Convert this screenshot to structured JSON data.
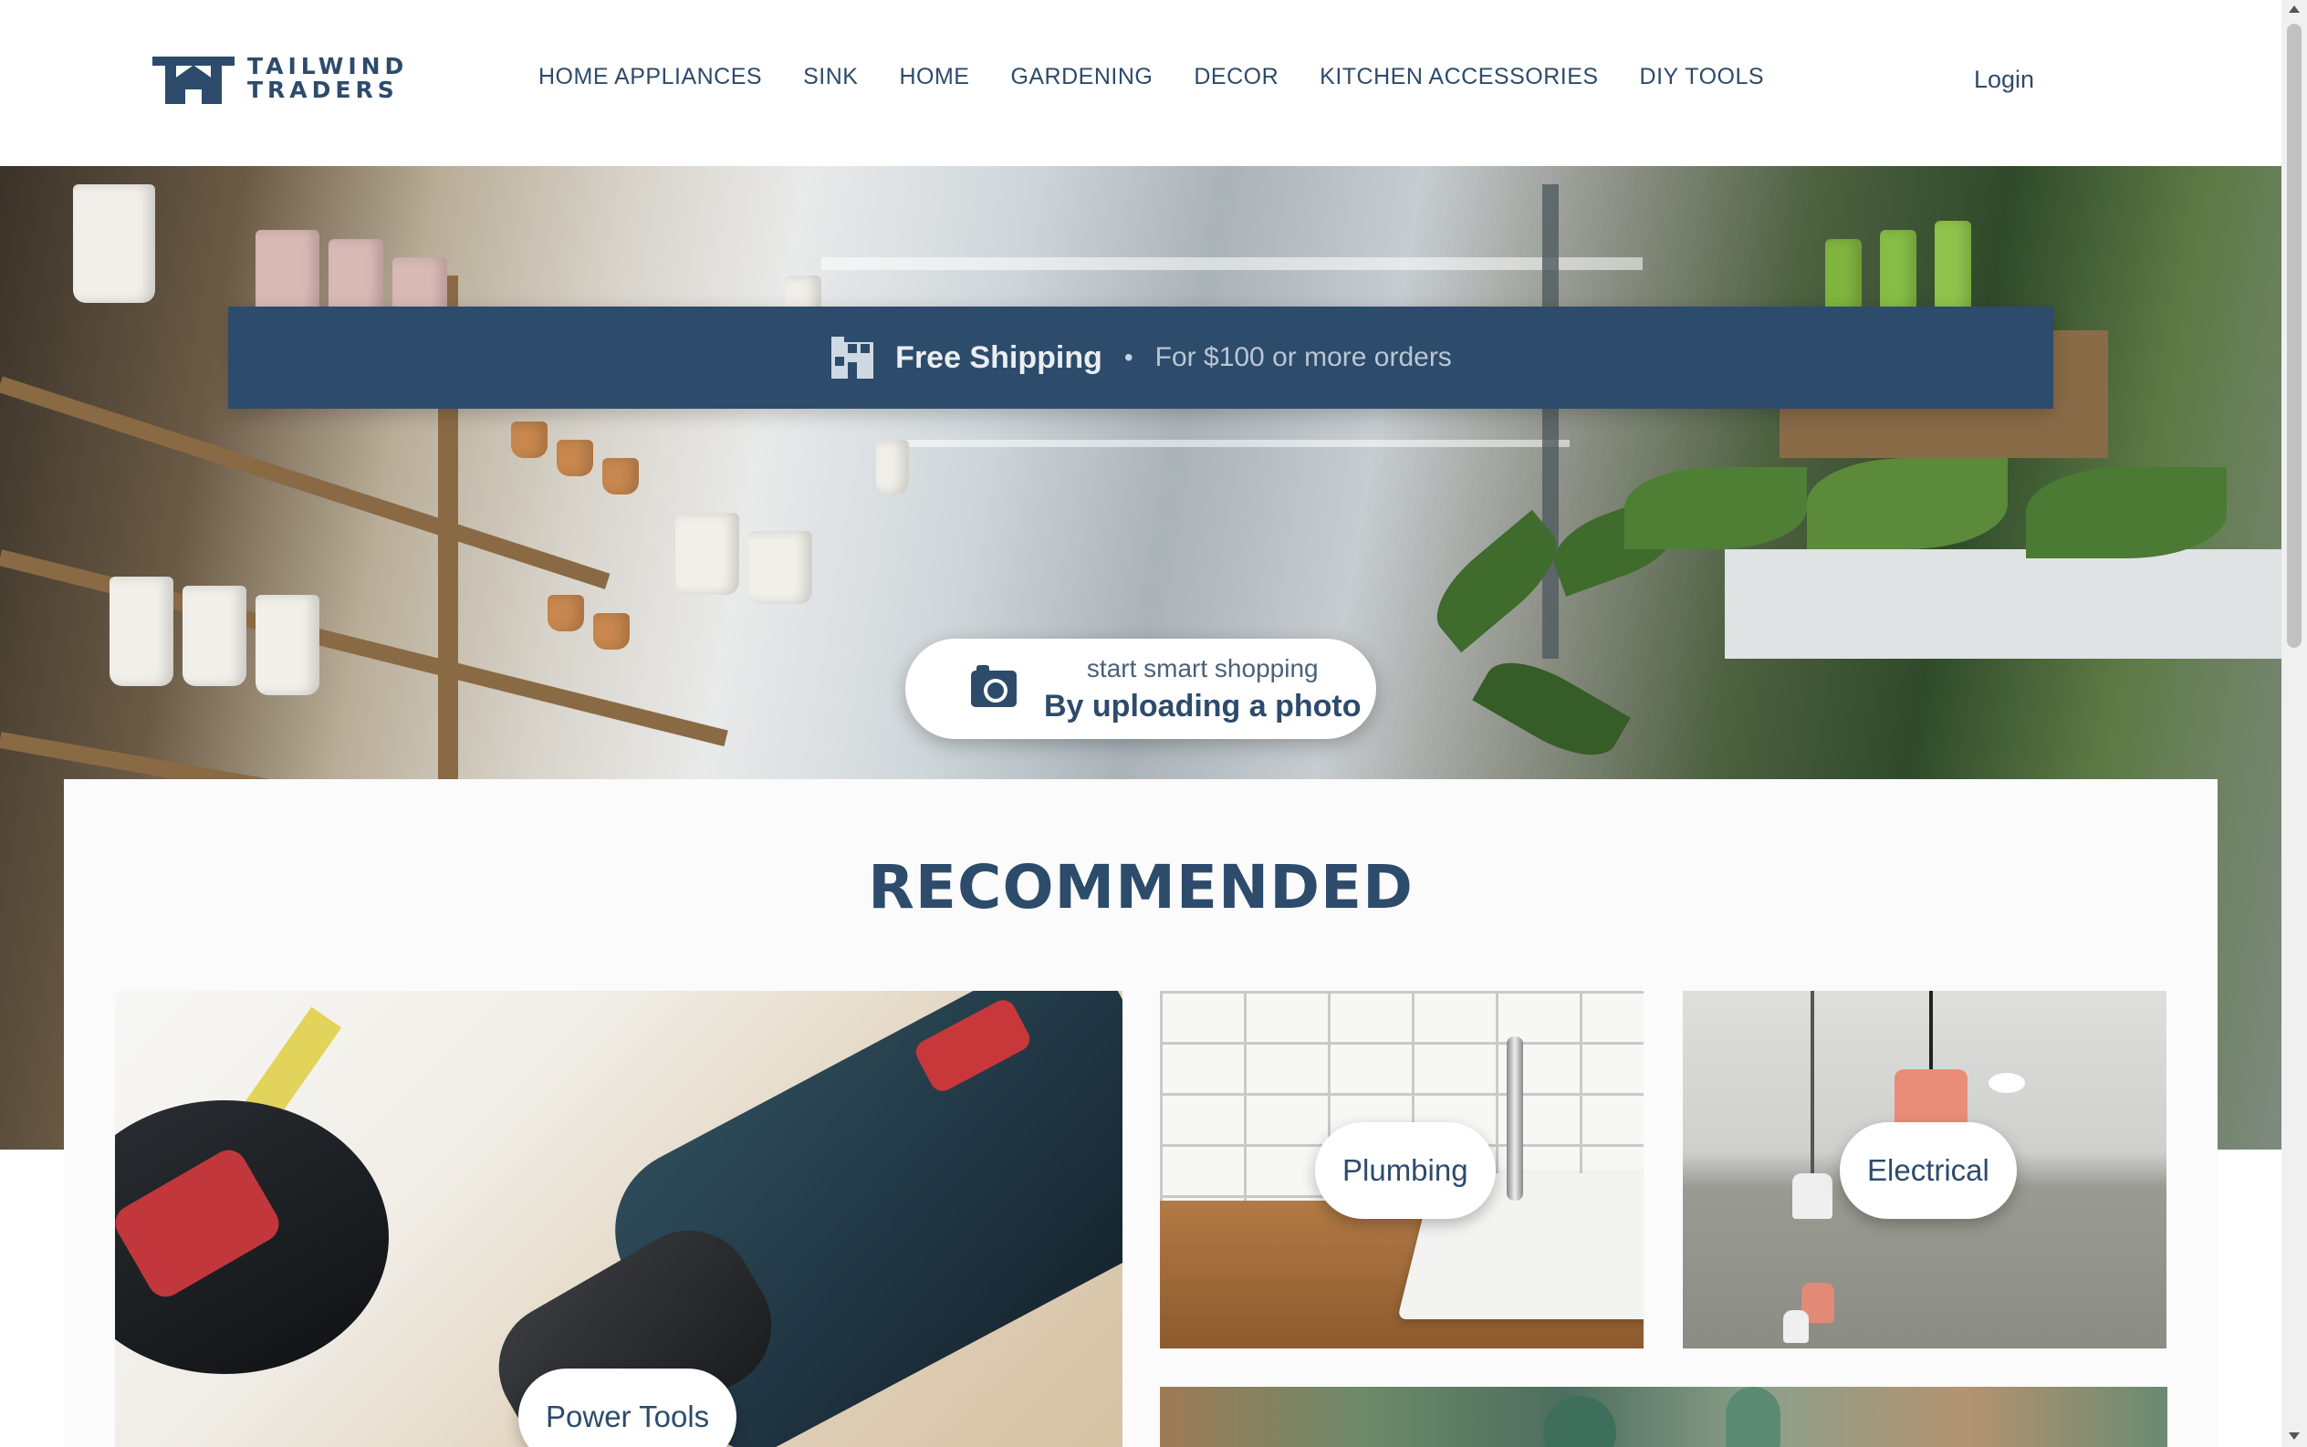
{
  "header": {
    "logo_line1": "TAILWIND",
    "logo_line2": "TRADERS",
    "nav": [
      {
        "label": "HOME APPLIANCES"
      },
      {
        "label": "SINK"
      },
      {
        "label": "HOME"
      },
      {
        "label": "GARDENING"
      },
      {
        "label": "DECOR"
      },
      {
        "label": "KITCHEN ACCESSORIES"
      },
      {
        "label": "DIY TOOLS"
      }
    ],
    "login_label": "Login"
  },
  "banner": {
    "title": "Free Shipping",
    "separator": "•",
    "subtitle": "For $100 or more orders",
    "icon": "building-box-icon"
  },
  "upload": {
    "small_text": "start smart shopping",
    "big_text": "By uploading a photo",
    "icon": "camera-icon"
  },
  "recommended": {
    "title": "RECOMMENDED",
    "cards": [
      {
        "label": "Power Tools"
      },
      {
        "label": "Plumbing"
      },
      {
        "label": "Electrical"
      }
    ]
  },
  "colors": {
    "brand": "#2d4b6b",
    "banner_bg": "#2d4b6b",
    "panel_bg": "#fbfbfb"
  }
}
